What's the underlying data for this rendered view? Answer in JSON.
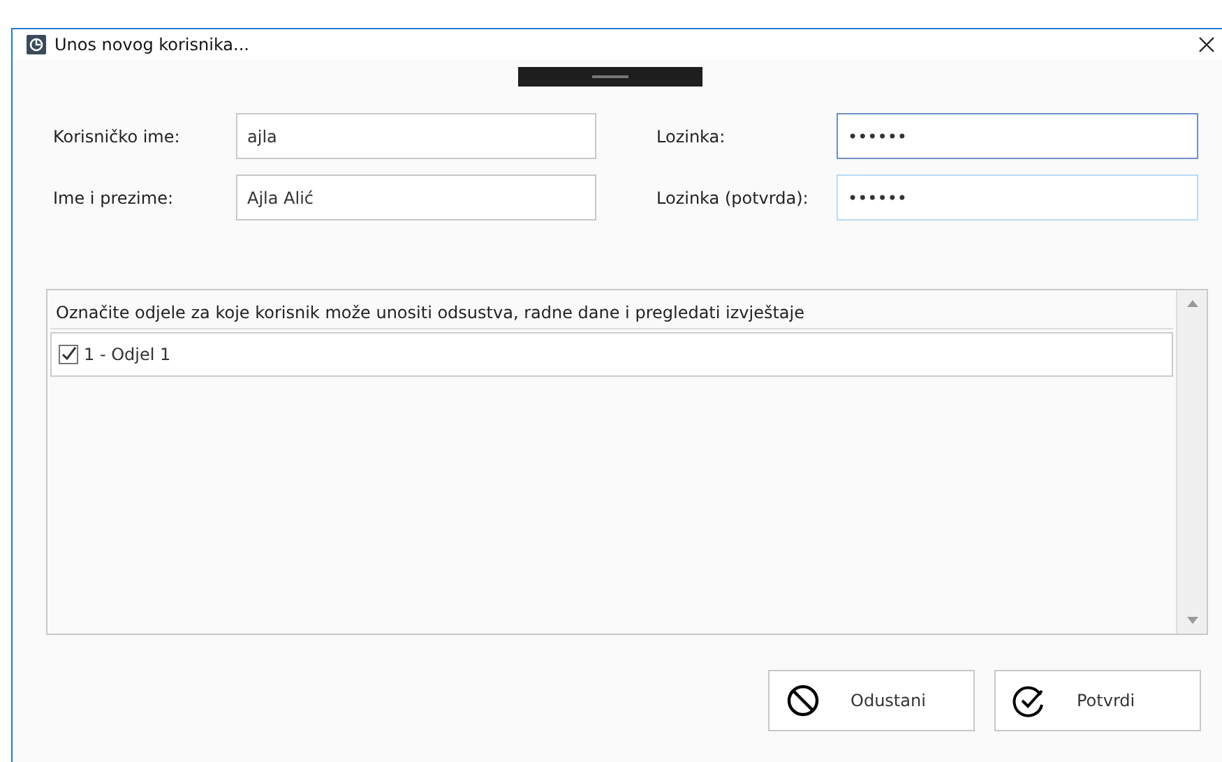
{
  "window": {
    "title": "Unos novog korisnika..."
  },
  "fields": [
    {
      "label": "Korisničko ime:",
      "value": "ajla",
      "focused": false,
      "hovered": false
    },
    {
      "label": "Lozinka:",
      "value": "••••••",
      "focused": true,
      "hovered": false
    },
    {
      "label": "Ime i prezime:",
      "value": "Ajla Alić",
      "focused": false,
      "hovered": false
    },
    {
      "label": "Lozinka (potvrda):",
      "value": "••••••",
      "focused": false,
      "hovered": true
    }
  ],
  "departments": {
    "header": "Označite odjele za koje korisnik može unositi odsustva, radne dane i pregledati izvještaje",
    "items": [
      {
        "label": "1 - Odjel 1",
        "checked": true
      }
    ]
  },
  "buttons": [
    {
      "label": "Odustani",
      "kind": "cancel"
    },
    {
      "label": "Potvrdi",
      "kind": "confirm"
    }
  ]
}
